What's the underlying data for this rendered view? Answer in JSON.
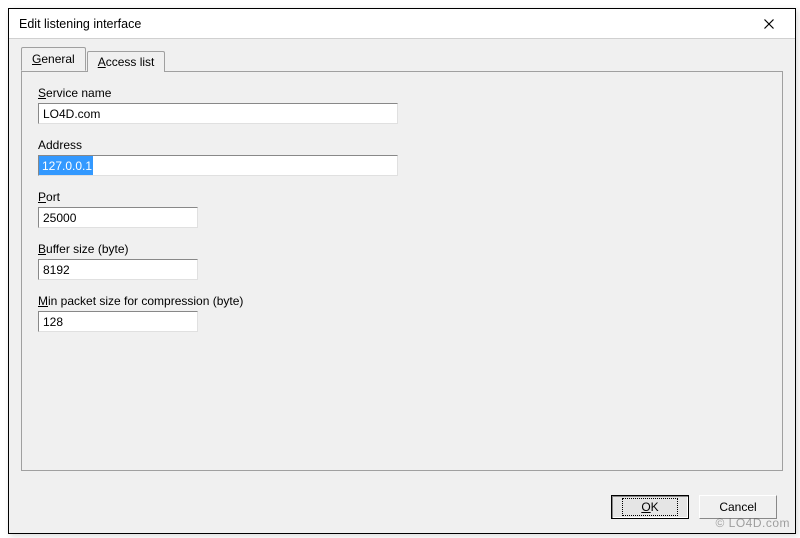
{
  "window": {
    "title": "Edit listening interface"
  },
  "tabs": {
    "general": {
      "prefix": "G",
      "rest": "eneral"
    },
    "access_list": {
      "prefix": "A",
      "rest": "ccess list"
    }
  },
  "fields": {
    "service_name": {
      "label_prefix": "S",
      "label_rest": "ervice name",
      "value": "LO4D.com"
    },
    "address": {
      "label": "Address",
      "value": "127.0.0.1"
    },
    "port": {
      "label_prefix": "P",
      "label_rest": "ort",
      "value": "25000"
    },
    "buffer_size": {
      "label_prefix": "B",
      "label_rest": "uffer size (byte)",
      "value": "8192"
    },
    "min_packet": {
      "label_prefix": "M",
      "label_rest": "in packet size for compression (byte)",
      "value": "128"
    }
  },
  "buttons": {
    "ok_prefix": "O",
    "ok_rest": "K",
    "cancel": "Cancel"
  },
  "watermark": "© LO4D.com"
}
